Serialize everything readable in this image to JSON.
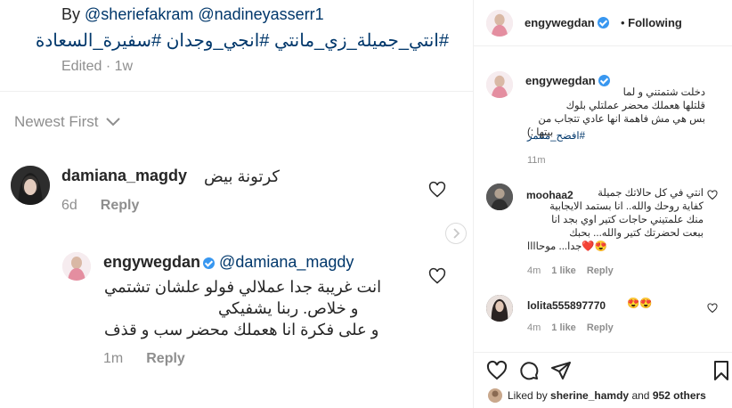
{
  "left": {
    "by_prefix": "By",
    "by_mentions": "@sheriefakram @nadineyasserr1",
    "hashtags": "#انتي_جميلة_زي_مانتي #انجي_وجدان #سفيرة_السعادة",
    "edited": "Edited · 1w",
    "sort_label": "Newest First",
    "comments": [
      {
        "user": "damiana_magdy",
        "text": "كرتونة بيض",
        "time": "6d",
        "reply": "Reply"
      },
      {
        "user": "engywegdan",
        "mention": "@damiana_magdy",
        "lines": [
          "انت غريبة جدا عملالي فولو علشان تشتمي",
          "و خلاص. ربنا يشفيكي",
          "و على فكرة انا هعملك محضر سب و قذف"
        ],
        "time": "1m",
        "reply": "Reply"
      }
    ]
  },
  "right": {
    "header": {
      "username": "engywegdan",
      "follow_label": "Following"
    },
    "caption": {
      "username": "engywegdan",
      "lines": [
        "دخلت شتمتني و لما",
        "قلتلها هعملك محضر عملتلي بلوك",
        "بس هي مش فاهمة انها عادي تتجاب من",
        "بيتها :)"
      ],
      "hashtag": "#افضح_متنمر",
      "time": "11m"
    },
    "comments": [
      {
        "user": "moohaa2",
        "lines": [
          "انتي في كل حالاتك جميلة",
          "كفاية روحك والله.. انا بستمد الايجابية",
          "منك علمتيني حاجات كتير اوي بجد انا",
          "ببعت لحضرتك كتير والله... بحبك",
          "😍❤️جدا... موحاااا"
        ],
        "time": "4m",
        "likes": "1 like",
        "reply": "Reply"
      },
      {
        "user": "lolita555897770",
        "text": "😍😍",
        "time": "4m",
        "likes": "1 like",
        "reply": "Reply"
      }
    ],
    "likes_text_prefix": "Liked by",
    "likes_user": "sherine_hamdy",
    "likes_text_mid": "and",
    "likes_count": "952 others"
  }
}
